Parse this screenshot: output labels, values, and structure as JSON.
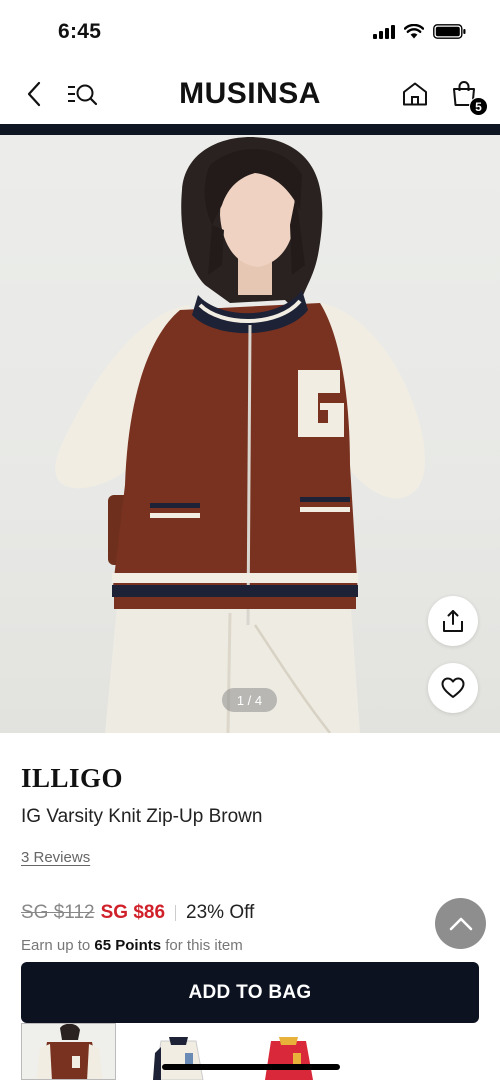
{
  "status_bar": {
    "time": "6:45"
  },
  "nav": {
    "brand": "MUSINSA",
    "bag_count": "5"
  },
  "gallery": {
    "counter": "1 / 4"
  },
  "product": {
    "brand": "ILLIGO",
    "title": "IG Varsity Knit Zip-Up Brown",
    "reviews": "3 Reviews",
    "original_price": "SG $112",
    "sale_price": "SG $86",
    "discount": "23% Off",
    "points_prefix": "Earn up to ",
    "points_value": "65 Points",
    "points_suffix": " for this item"
  },
  "actions": {
    "add_to_bag": "ADD TO BAG"
  },
  "colors": {
    "accent": "#0c1220",
    "sale": "#d0202a",
    "scroll_top": "#8e8e8e"
  },
  "icons": [
    "back-icon",
    "menu-search-icon",
    "home-icon",
    "bag-icon",
    "share-icon",
    "heart-icon",
    "chevron-up-icon"
  ]
}
